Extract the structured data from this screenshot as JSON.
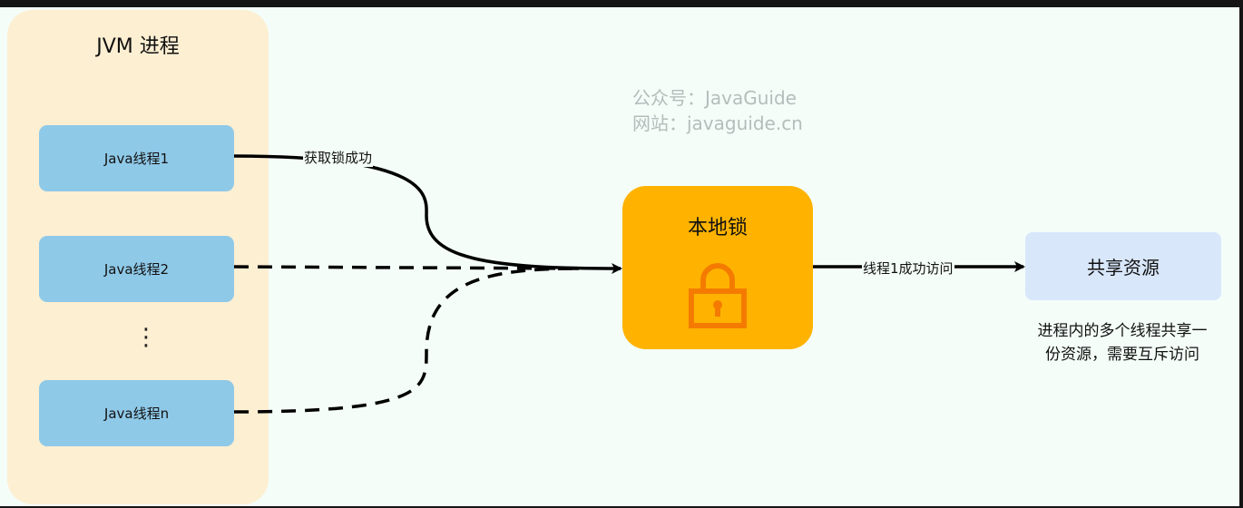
{
  "jvm": {
    "title": "JVM 进程",
    "threads": [
      "Java线程1",
      "Java线程2",
      "Java线程n"
    ],
    "ellipsis": "⋮"
  },
  "watermark": {
    "line1": "公众号：JavaGuide",
    "line2": "网站：javaguide.cn"
  },
  "lock": {
    "title": "本地锁",
    "icon": "padlock-icon"
  },
  "edges": {
    "acquire_label": "获取锁成功",
    "access_label": "线程1成功访问"
  },
  "resource": {
    "label": "共享资源"
  },
  "note": {
    "line1": "进程内的多个线程共享一",
    "line2": "份资源，需要互斥访问"
  },
  "colors": {
    "jvm_bg": "#fdefd2",
    "thread_bg": "#8fc9e8",
    "lock_bg": "#ffb300",
    "lock_icon": "#f47b00",
    "resource_bg": "#d9e7fb",
    "canvas_bg": "#f4fdf8"
  }
}
